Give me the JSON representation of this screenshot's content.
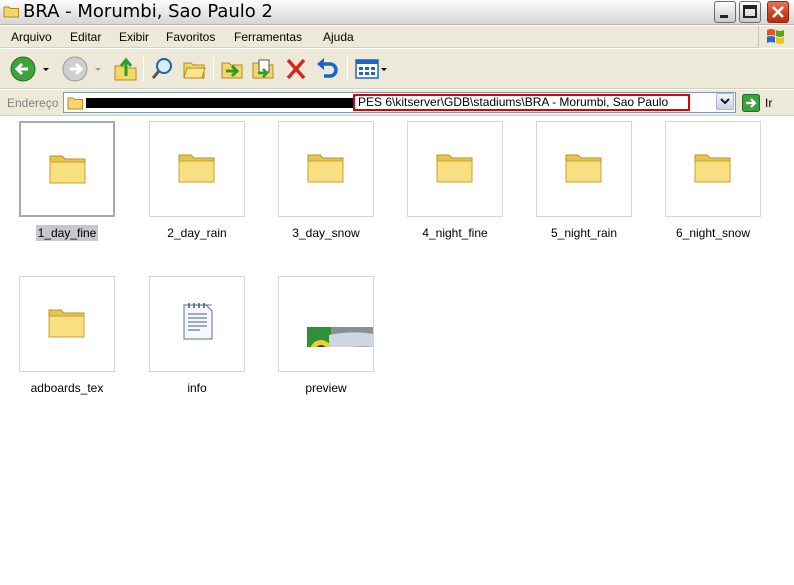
{
  "window": {
    "title": "BRA - Morumbi, Sao Paulo 2"
  },
  "menu": {
    "items": [
      "Arquivo",
      "Editar",
      "Exibir",
      "Favoritos",
      "Ferramentas",
      "Ajuda"
    ]
  },
  "toolbar": {
    "buttons": [
      "back-icon",
      "forward-icon",
      "up-folder-icon",
      "search-icon",
      "folders-icon",
      "move-to-icon",
      "copy-to-icon",
      "delete-icon",
      "undo-icon",
      "views-icon"
    ]
  },
  "address": {
    "label": "Endereço",
    "path": "PES 6\\kitserver\\GDB\\stadiums\\BRA - Morumbi, Sao Paulo",
    "go_label": "Ir",
    "highlight_color": "#e00000"
  },
  "files": [
    {
      "name": "1_day_fine",
      "type": "folder",
      "selected": true
    },
    {
      "name": "2_day_rain",
      "type": "folder",
      "selected": false
    },
    {
      "name": "3_day_snow",
      "type": "folder",
      "selected": false
    },
    {
      "name": "4_night_fine",
      "type": "folder",
      "selected": false
    },
    {
      "name": "5_night_rain",
      "type": "folder",
      "selected": false
    },
    {
      "name": "6_night_snow",
      "type": "folder",
      "selected": false
    },
    {
      "name": "adboards_tex",
      "type": "folder",
      "selected": false
    },
    {
      "name": "info",
      "type": "text-file",
      "selected": false
    },
    {
      "name": "preview",
      "type": "image",
      "selected": false
    }
  ]
}
